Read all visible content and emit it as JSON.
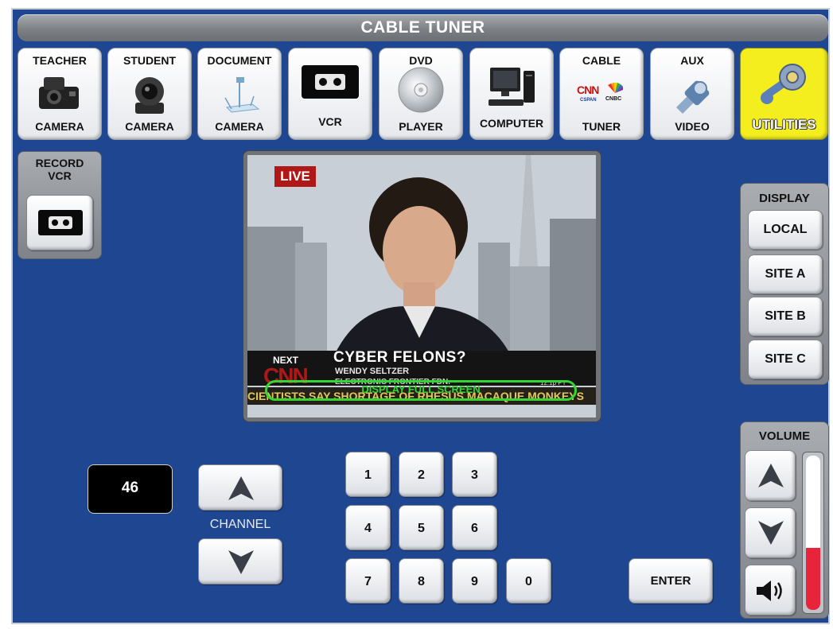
{
  "header": {
    "title": "CABLE TUNER"
  },
  "sources": [
    {
      "top": "TEACHER",
      "bottom": "CAMERA",
      "icon": "document-camera-icon"
    },
    {
      "top": "STUDENT",
      "bottom": "CAMERA",
      "icon": "ptz-camera-icon"
    },
    {
      "top": "DOCUMENT",
      "bottom": "CAMERA",
      "icon": "document-camera-arm-icon"
    },
    {
      "top": "",
      "bottom": "VCR",
      "icon": "vhs-tape-icon"
    },
    {
      "top": "DVD",
      "bottom": "PLAYER",
      "icon": "disc-icon"
    },
    {
      "top": "",
      "bottom": "COMPUTER",
      "icon": "computer-icon"
    },
    {
      "top": "CABLE",
      "bottom": "TUNER",
      "icon": "cable-networks-icon"
    },
    {
      "top": "AUX",
      "bottom": "VIDEO",
      "icon": "connector-icon"
    },
    {
      "top": "",
      "bottom": "UTILITIES",
      "icon": "wrench-gear-icon"
    }
  ],
  "cable_logos": {
    "cnn": "CNN",
    "cspan": "CSPAN",
    "cnbc": "CNBC"
  },
  "record": {
    "line1": "RECORD",
    "line2": "VCR"
  },
  "video": {
    "live": "LIVE",
    "next": "NEXT",
    "headline": "CYBER FELONS?",
    "name": "WENDY SELTZER",
    "org": "ELECTRONIC FRONTIER FDN.",
    "ticker": "CIENTISTS SAY SHORTAGE OF RHESUS MACAQUE MONKEYS",
    "network": "CNN",
    "clock": "12:1p PT",
    "fullscreen_label": "DISPLAY FULL SCREEN"
  },
  "display": {
    "title": "DISPLAY",
    "options": [
      "LOCAL",
      "SITE A",
      "SITE B",
      "SITE C"
    ]
  },
  "channel": {
    "value": "46",
    "label": "CHANNEL"
  },
  "keypad": [
    "1",
    "2",
    "3",
    "4",
    "5",
    "6",
    "7",
    "8",
    "9",
    "0"
  ],
  "enter_label": "ENTER",
  "volume": {
    "title": "VOLUME",
    "level": 0.4
  },
  "colors": {
    "panel": "#1f4690",
    "accent_yellow": "#f4ee1e",
    "volume_fill": "#e8243a",
    "ring": "#33d633"
  }
}
